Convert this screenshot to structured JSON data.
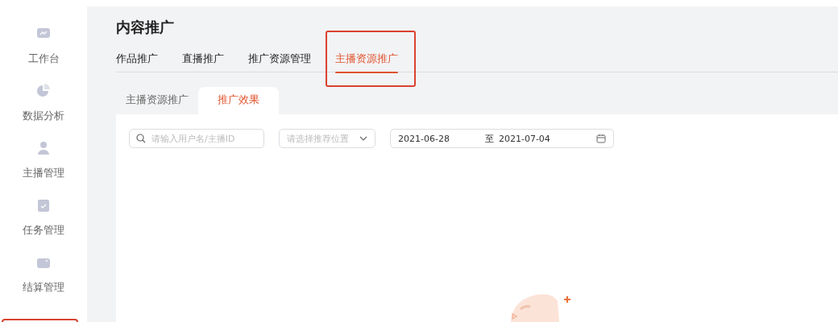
{
  "sidebar": {
    "items": [
      {
        "label": "工作台"
      },
      {
        "label": "数据分析"
      },
      {
        "label": "主播管理"
      },
      {
        "label": "任务管理"
      },
      {
        "label": "结算管理"
      }
    ],
    "bottom_highlight": true
  },
  "page": {
    "title": "内容推广"
  },
  "tabs": [
    {
      "label": "作品推广",
      "selected": false,
      "highlighted": false
    },
    {
      "label": "直播推广",
      "selected": false,
      "highlighted": false
    },
    {
      "label": "推广资源管理",
      "selected": false,
      "highlighted": false
    },
    {
      "label": "主播资源推广",
      "selected": true,
      "highlighted": true
    }
  ],
  "subtabs": [
    {
      "label": "主播资源推广",
      "selected": false
    },
    {
      "label": "推广效果",
      "selected": true
    }
  ],
  "filters": {
    "search": {
      "placeholder": "请输入用户名/主播ID"
    },
    "select": {
      "placeholder": "请选择推荐位置"
    },
    "date_range": {
      "start": "2021-06-28",
      "separator": "至",
      "end": "2021-07-04"
    }
  }
}
